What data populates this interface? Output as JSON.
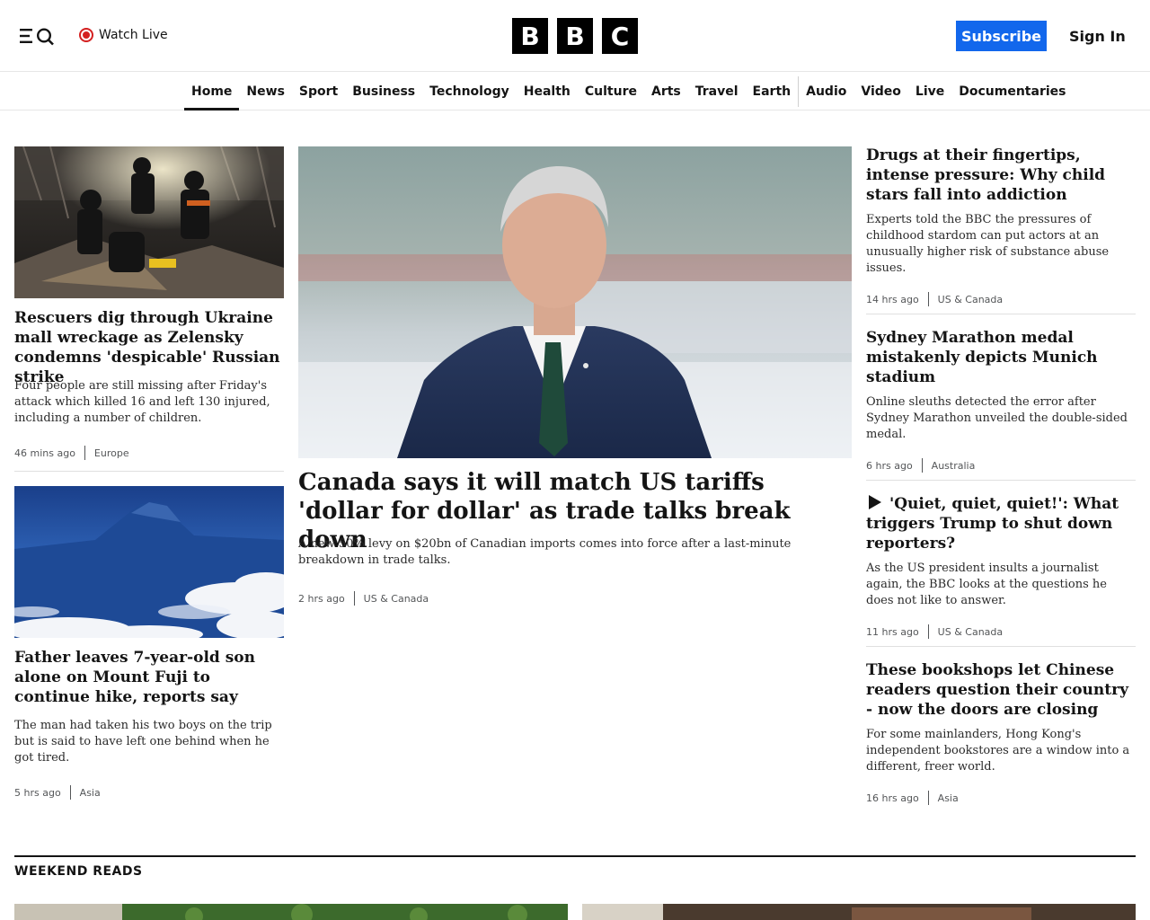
{
  "header": {
    "watch_live": "Watch Live",
    "logo_letters": [
      "B",
      "B",
      "C"
    ],
    "subscribe": "Subscribe",
    "sign_in": "Sign In"
  },
  "nav": {
    "items": [
      "Home",
      "News",
      "Sport",
      "Business",
      "Technology",
      "Health",
      "Culture",
      "Arts",
      "Travel",
      "Earth",
      "Audio",
      "Video",
      "Live",
      "Documentaries"
    ],
    "active": "Home"
  },
  "left": [
    {
      "headline": "Rescuers dig through Ukraine mall wreckage as Zelensky condemns 'despicable' Russian strike",
      "summary": "Four people are still missing after Friday's attack which killed 16 and left 130 injured, including a number of children.",
      "time": "46 mins ago",
      "tag": "Europe"
    },
    {
      "headline": "Father leaves 7-year-old son alone on Mount Fuji to continue hike, reports say",
      "summary": "The man had taken his two boys on the trip but is said to have left one behind when he got tired.",
      "time": "5 hrs ago",
      "tag": "Asia"
    }
  ],
  "main": {
    "headline": "Canada says it will match US tariffs 'dollar for dollar' as trade talks break down",
    "summary": "A new 50% levy on $20bn of Canadian imports comes into force after a last-minute breakdown in trade talks.",
    "time": "2 hrs ago",
    "tag": "US & Canada"
  },
  "right": [
    {
      "headline": "Drugs at their fingertips, intense pressure: Why child stars fall into addiction",
      "summary": "Experts told the BBC the pressures of childhood stardom can put actors at an unusually higher risk of substance abuse issues.",
      "time": "14 hrs ago",
      "tag": "US & Canada"
    },
    {
      "headline": "Sydney Marathon medal mistakenly depicts Munich stadium",
      "summary": "Online sleuths detected the error after Sydney Marathon unveiled the double-sided medal.",
      "time": "6 hrs ago",
      "tag": "Australia"
    },
    {
      "headline": "'Quiet, quiet, quiet!': What triggers Trump to shut down reporters?",
      "summary": "As the US president insults a journalist again, the BBC looks at the questions he does not like to answer.",
      "time": "11 hrs ago",
      "tag": "US & Canada",
      "icon": "play-icon"
    },
    {
      "headline": "These bookshops let Chinese readers question their country - now the doors are closing",
      "summary": "For some mainlanders, Hong Kong's independent bookstores are a window into a different, freer world.",
      "time": "16 hrs ago",
      "tag": "Asia"
    }
  ],
  "section": {
    "title": "WEEKEND READS"
  },
  "colors": {
    "brand": "#000000",
    "subscribe": "#1267ec",
    "live": "#d42020"
  }
}
